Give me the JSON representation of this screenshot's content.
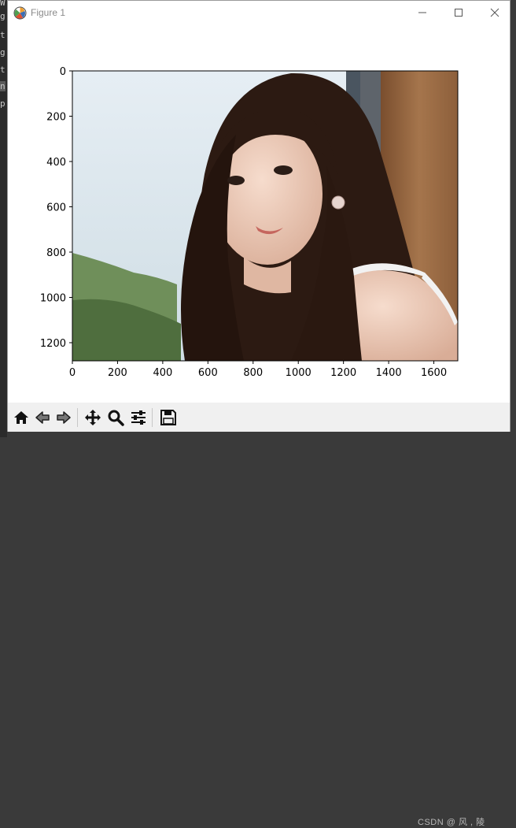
{
  "window": {
    "title": "Figure 1",
    "minimize_label": "minimize",
    "maximize_label": "maximize",
    "close_label": "close"
  },
  "left_strip": {
    "chars": [
      "W",
      "g",
      "t",
      "g",
      "t",
      "n",
      "p"
    ]
  },
  "toolbar": {
    "tools": [
      {
        "name": "home",
        "icon": "home-icon"
      },
      {
        "name": "back",
        "icon": "back-arrow-icon"
      },
      {
        "name": "forward",
        "icon": "forward-arrow-icon"
      },
      {
        "name": "pan",
        "icon": "move-icon"
      },
      {
        "name": "zoom",
        "icon": "zoom-icon"
      },
      {
        "name": "configure-subplots",
        "icon": "sliders-icon"
      },
      {
        "name": "save",
        "icon": "save-icon"
      }
    ]
  },
  "watermark": "CSDN @ 风 , 陵",
  "chart_data": {
    "type": "image",
    "image_description_hint": "",
    "x_ticks": [
      0,
      200,
      400,
      600,
      800,
      1000,
      1200,
      1400,
      1600
    ],
    "y_ticks": [
      0,
      200,
      400,
      600,
      800,
      1000,
      1200
    ],
    "xlim": [
      0,
      1706
    ],
    "ylim_inverted": [
      0,
      1280
    ],
    "grid": false
  },
  "colors": {
    "sky": "#dbe7ef",
    "hair": "#2a1a14",
    "skin": "#e9c8b6",
    "wood": "#9c6b45",
    "foliage": "#5d7a4c"
  }
}
